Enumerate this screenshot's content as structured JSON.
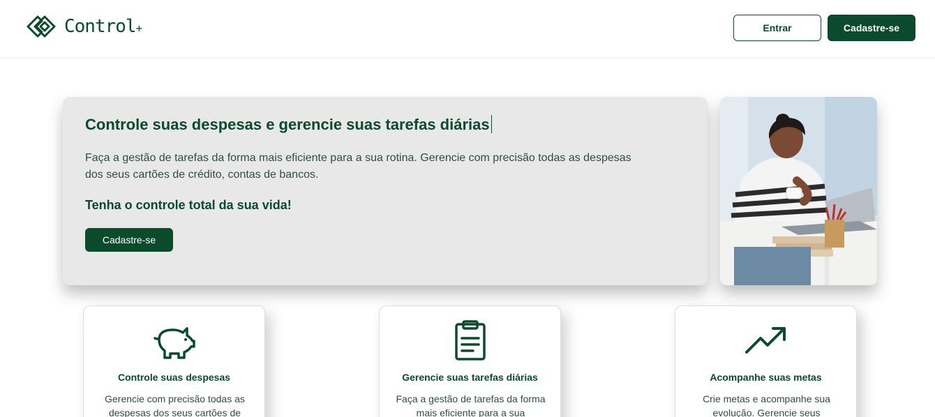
{
  "header": {
    "brand": "Control",
    "brand_plus": "+",
    "login_label": "Entrar",
    "signup_label": "Cadastre-se"
  },
  "hero": {
    "title": "Controle suas despesas e gerencie suas tarefas diárias",
    "description": "Faça a gestão de tarefas da forma mais eficiente para a sua rotina. Gerencie com precisão todas as despesas dos seus cartões de crédito, contas de bancos.",
    "subtitle": "Tenha o controle total da sua vida!",
    "cta_label": "Cadastre-se"
  },
  "features": [
    {
      "icon": "piggy-bank-icon",
      "title": "Controle suas despesas",
      "text": "Gerencie com precisão todas as despesas dos seus cartões de"
    },
    {
      "icon": "clipboard-icon",
      "title": "Gerencie suas tarefas diárias",
      "text": "Faça a gestão de tarefas da forma mais eficiente para a sua"
    },
    {
      "icon": "trending-up-icon",
      "title": "Acompanhe suas metas",
      "text": "Crie metas e acompanhe sua evolução. Gerencie seus"
    }
  ],
  "colors": {
    "brand": "#0b4a2d",
    "hero_bg": "#e8e8e8",
    "text": "#2e4e3f"
  }
}
